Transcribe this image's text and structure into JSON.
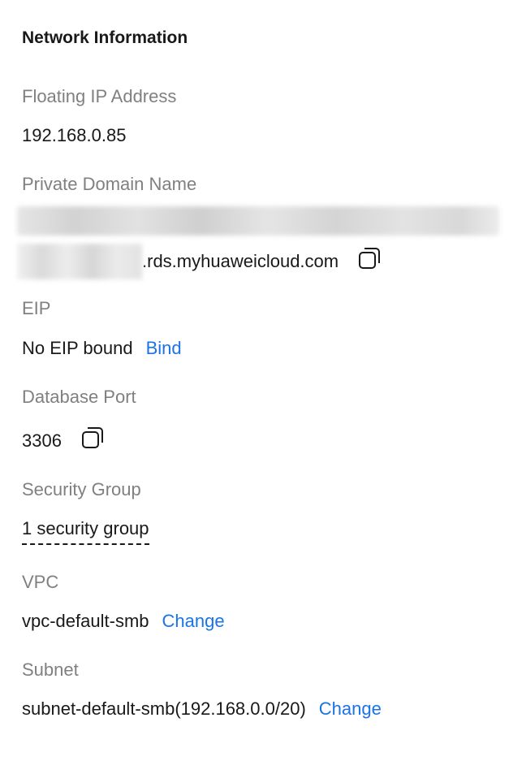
{
  "section": {
    "title": "Network Information"
  },
  "floating_ip": {
    "label": "Floating IP Address",
    "value": "192.168.0.85"
  },
  "private_domain": {
    "label": "Private Domain Name",
    "value_suffix": ".rds.myhuaweicloud.com",
    "copy_icon": "copy-icon"
  },
  "eip": {
    "label": "EIP",
    "value": "No EIP bound",
    "action": "Bind"
  },
  "database_port": {
    "label": "Database Port",
    "value": "3306",
    "copy_icon": "copy-icon"
  },
  "security_group": {
    "label": "Security Group",
    "value": "1 security group"
  },
  "vpc": {
    "label": "VPC",
    "value": "vpc-default-smb",
    "action": "Change"
  },
  "subnet": {
    "label": "Subnet",
    "value": "subnet-default-smb(192.168.0.0/20)",
    "action": "Change"
  },
  "colors": {
    "link": "#1a73e8",
    "label": "#808080",
    "text": "#191919"
  }
}
